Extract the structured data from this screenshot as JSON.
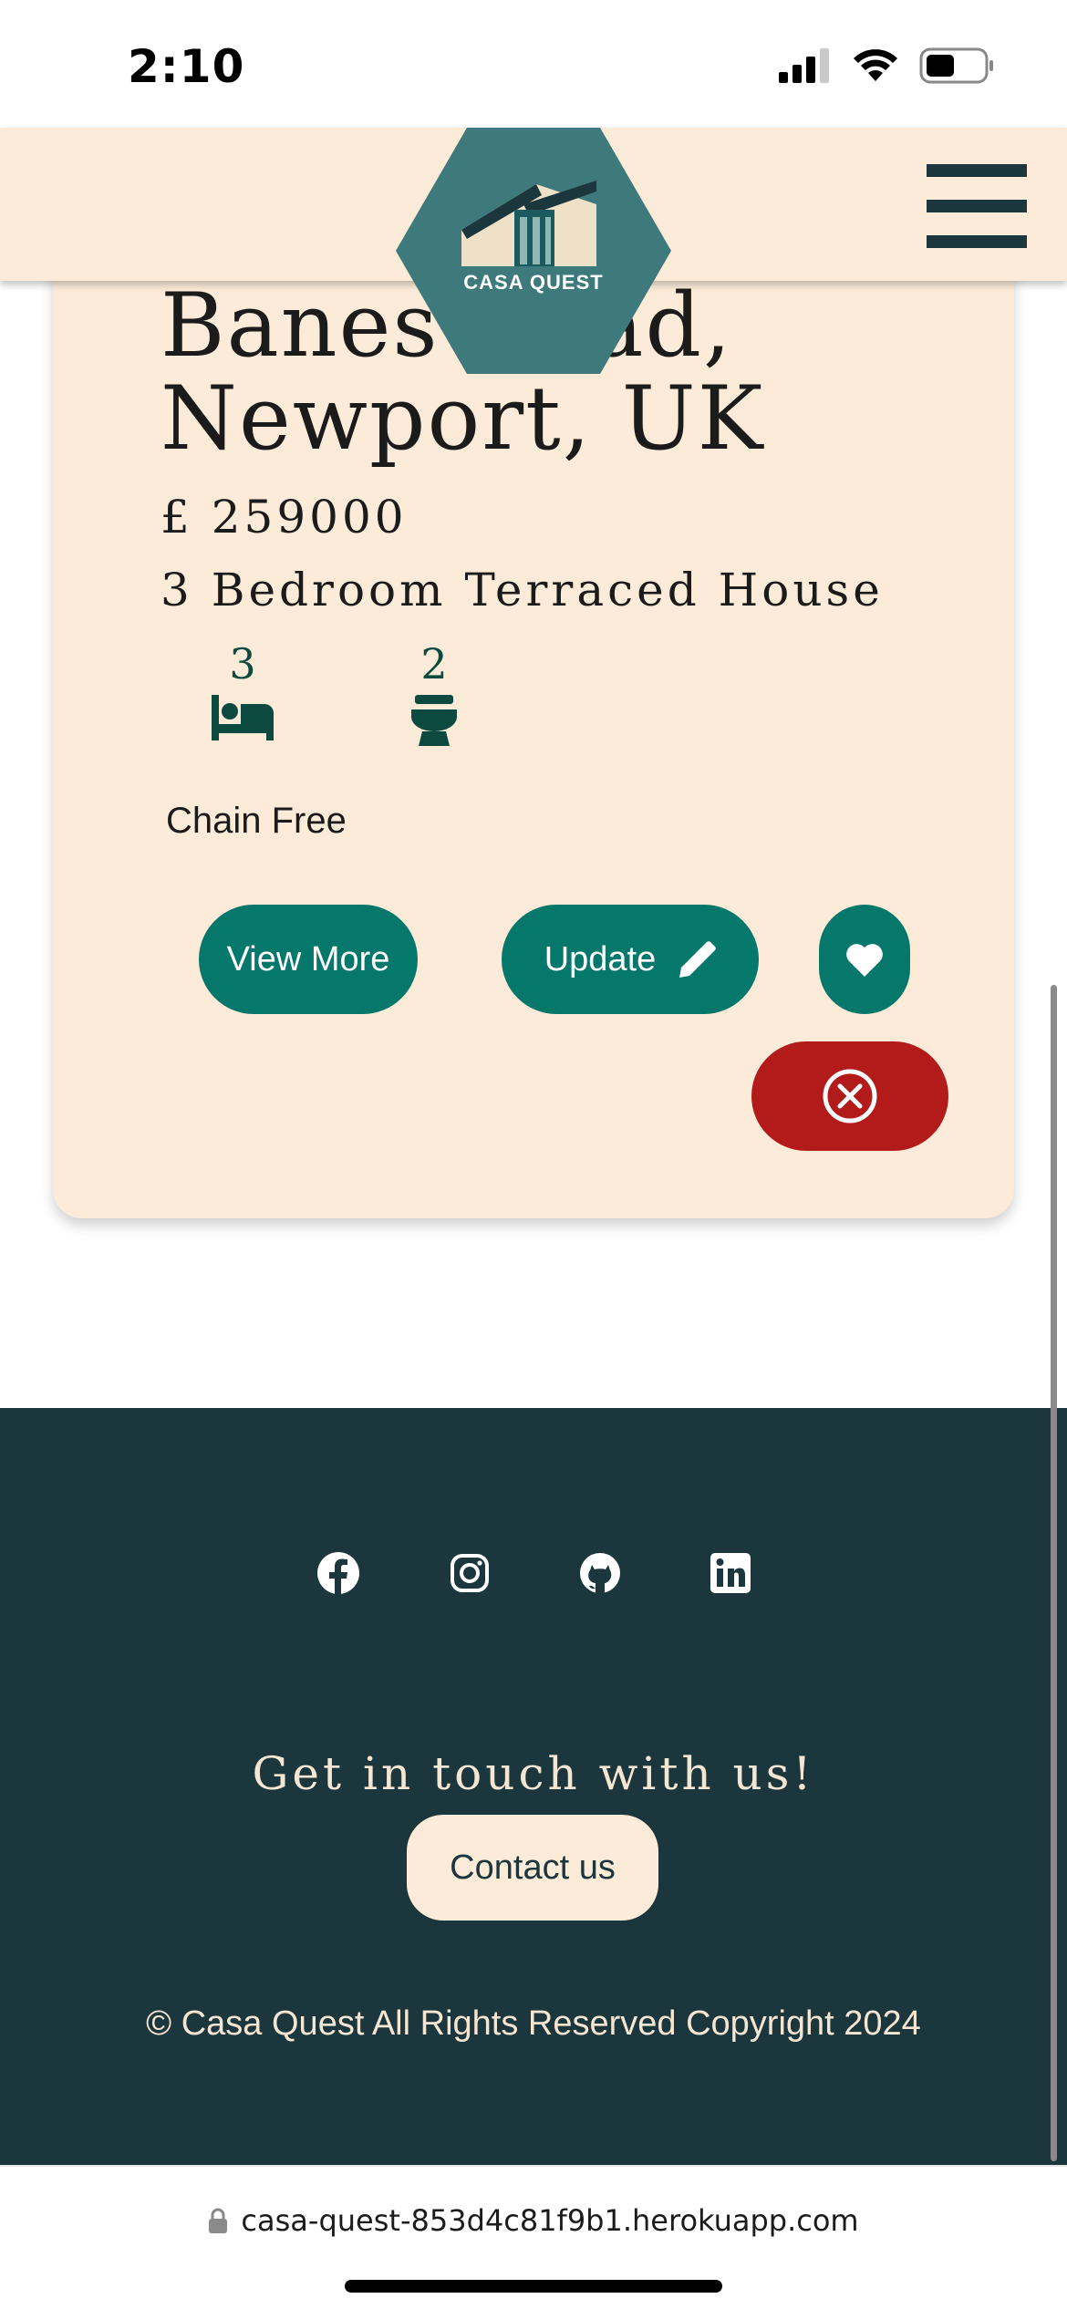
{
  "status_bar": {
    "time": "2:10",
    "icons": [
      "signal-icon",
      "wifi-icon",
      "battery-icon"
    ]
  },
  "header": {
    "logo_text": "CASA QUEST",
    "menu_icon": "hamburger-menu-icon"
  },
  "listing": {
    "address": "Banes Road, Newport, UK",
    "price": "£ 259000",
    "property_type": "3 Bedroom Terraced House",
    "bedrooms": "3",
    "bathrooms": "2",
    "chain_status": "Chain Free",
    "buttons": {
      "view_more": "View More",
      "update": "Update",
      "favourite_icon": "heart-icon",
      "delete_icon": "close-circle-icon"
    }
  },
  "footer": {
    "social": [
      "facebook-icon",
      "instagram-icon",
      "github-icon",
      "linkedin-icon"
    ],
    "heading": "Get in touch with us!",
    "contact_label": "Contact us",
    "copyright": "© Casa Quest All Rights Reserved Copyright 2024"
  },
  "browser": {
    "url": "casa-quest-853d4c81f9b1.herokuapp.com"
  },
  "colors": {
    "cream": "#fbebd8",
    "teal": "#06786b",
    "dark_teal": "#1b363c",
    "logo_teal": "#3e7a7b",
    "danger": "#b31b1b"
  }
}
